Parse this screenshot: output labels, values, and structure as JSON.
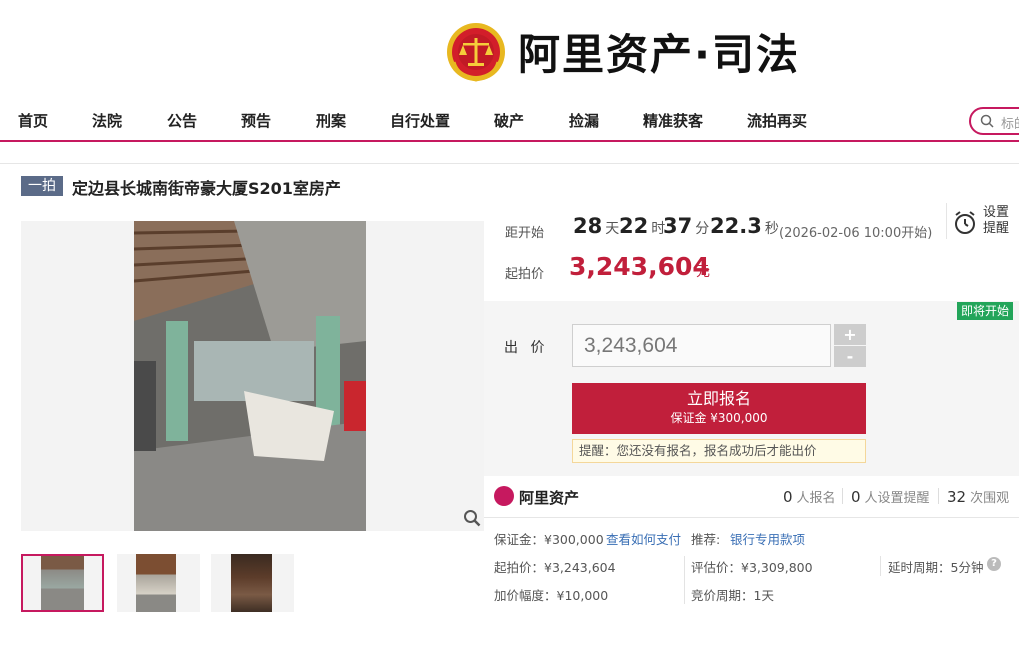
{
  "header": {
    "logo_text": "阿里资产·司法"
  },
  "nav": {
    "items": [
      "首页",
      "法院",
      "公告",
      "预告",
      "刑案",
      "自行处置",
      "破产",
      "捡漏",
      "精准获客",
      "流拍再买"
    ],
    "search_placeholder": "标的"
  },
  "item": {
    "round_badge": "一拍",
    "title": "定边县长城南街帝豪大厦S201室房产"
  },
  "countdown": {
    "label": "距开始",
    "days": "28",
    "days_unit": "天",
    "hours": "22",
    "hours_unit": "时",
    "minutes": "37",
    "minutes_unit": "分",
    "seconds": "22.3",
    "seconds_unit": "秒",
    "start_time": "(2026-02-06 10:00开始)",
    "remind_label": "设置提醒"
  },
  "price": {
    "label": "起拍价",
    "value": "3,243,604",
    "unit": "元"
  },
  "bid": {
    "status_badge": "即将开始",
    "label": "出 价",
    "input_value": "3,243,604",
    "plus": "+",
    "minus": "-",
    "register_label": "立即报名",
    "deposit_label": "保证金 ¥300,000",
    "reminder": "提醒：您还没有报名，报名成功后才能出价"
  },
  "stats": {
    "brand": "阿里资产",
    "registered_count": "0",
    "registered_unit": "人报名",
    "remind_count": "0",
    "remind_unit": "人设置提醒",
    "views_count": "32",
    "views_unit": "次围观"
  },
  "info": {
    "deposit": "保证金：¥300,000",
    "how_to_pay": "查看如何支付",
    "recommend_label": "推荐:",
    "recommend_link": "银行专用款项",
    "start_price": "起拍价：¥3,243,604",
    "appraisal": "评估价：¥3,309,800",
    "delay": "延时周期：5分钟",
    "increment": "加价幅度：¥10,000",
    "bid_cycle": "竞价周期：1天"
  },
  "colors": {
    "brand": "#c6195f",
    "price_red": "#c11f3b",
    "status_green": "#23a55a",
    "link_blue": "#3a6fb5"
  }
}
